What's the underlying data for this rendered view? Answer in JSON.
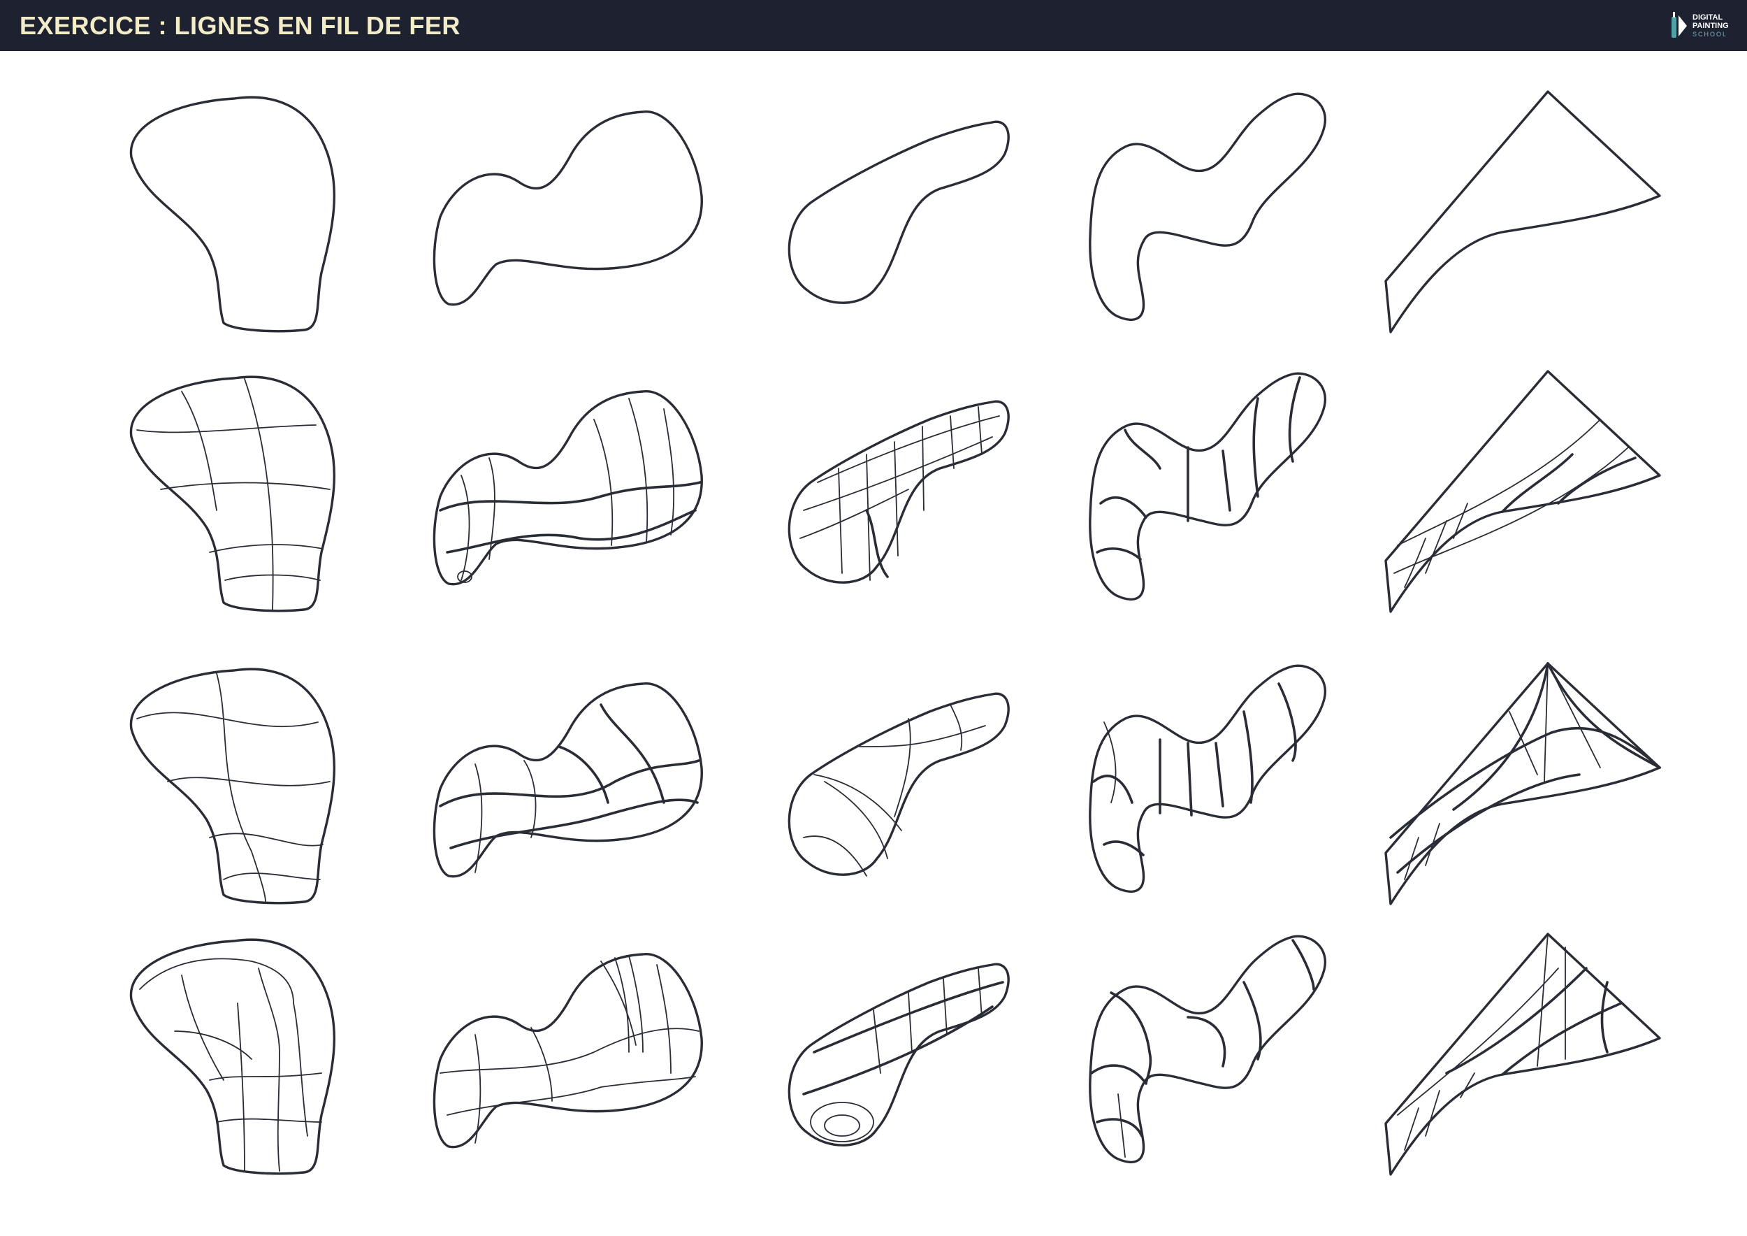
{
  "header": {
    "title": "EXERCICE : LIGNES EN FIL DE FER",
    "logo": {
      "line1": "DIGITAL",
      "line2": "PAINTING",
      "line3": "SCHOOL",
      "icon": "brush-logo-icon"
    }
  },
  "colors": {
    "header_bg": "#1e2230",
    "title": "#f3ecc9",
    "ink": "#2a2c36",
    "logo_accent": "#4fa3a7"
  },
  "grid": {
    "rows": 4,
    "columns": 5,
    "row_roles": [
      "outline",
      "wireframe",
      "wireframe",
      "wireframe"
    ]
  }
}
